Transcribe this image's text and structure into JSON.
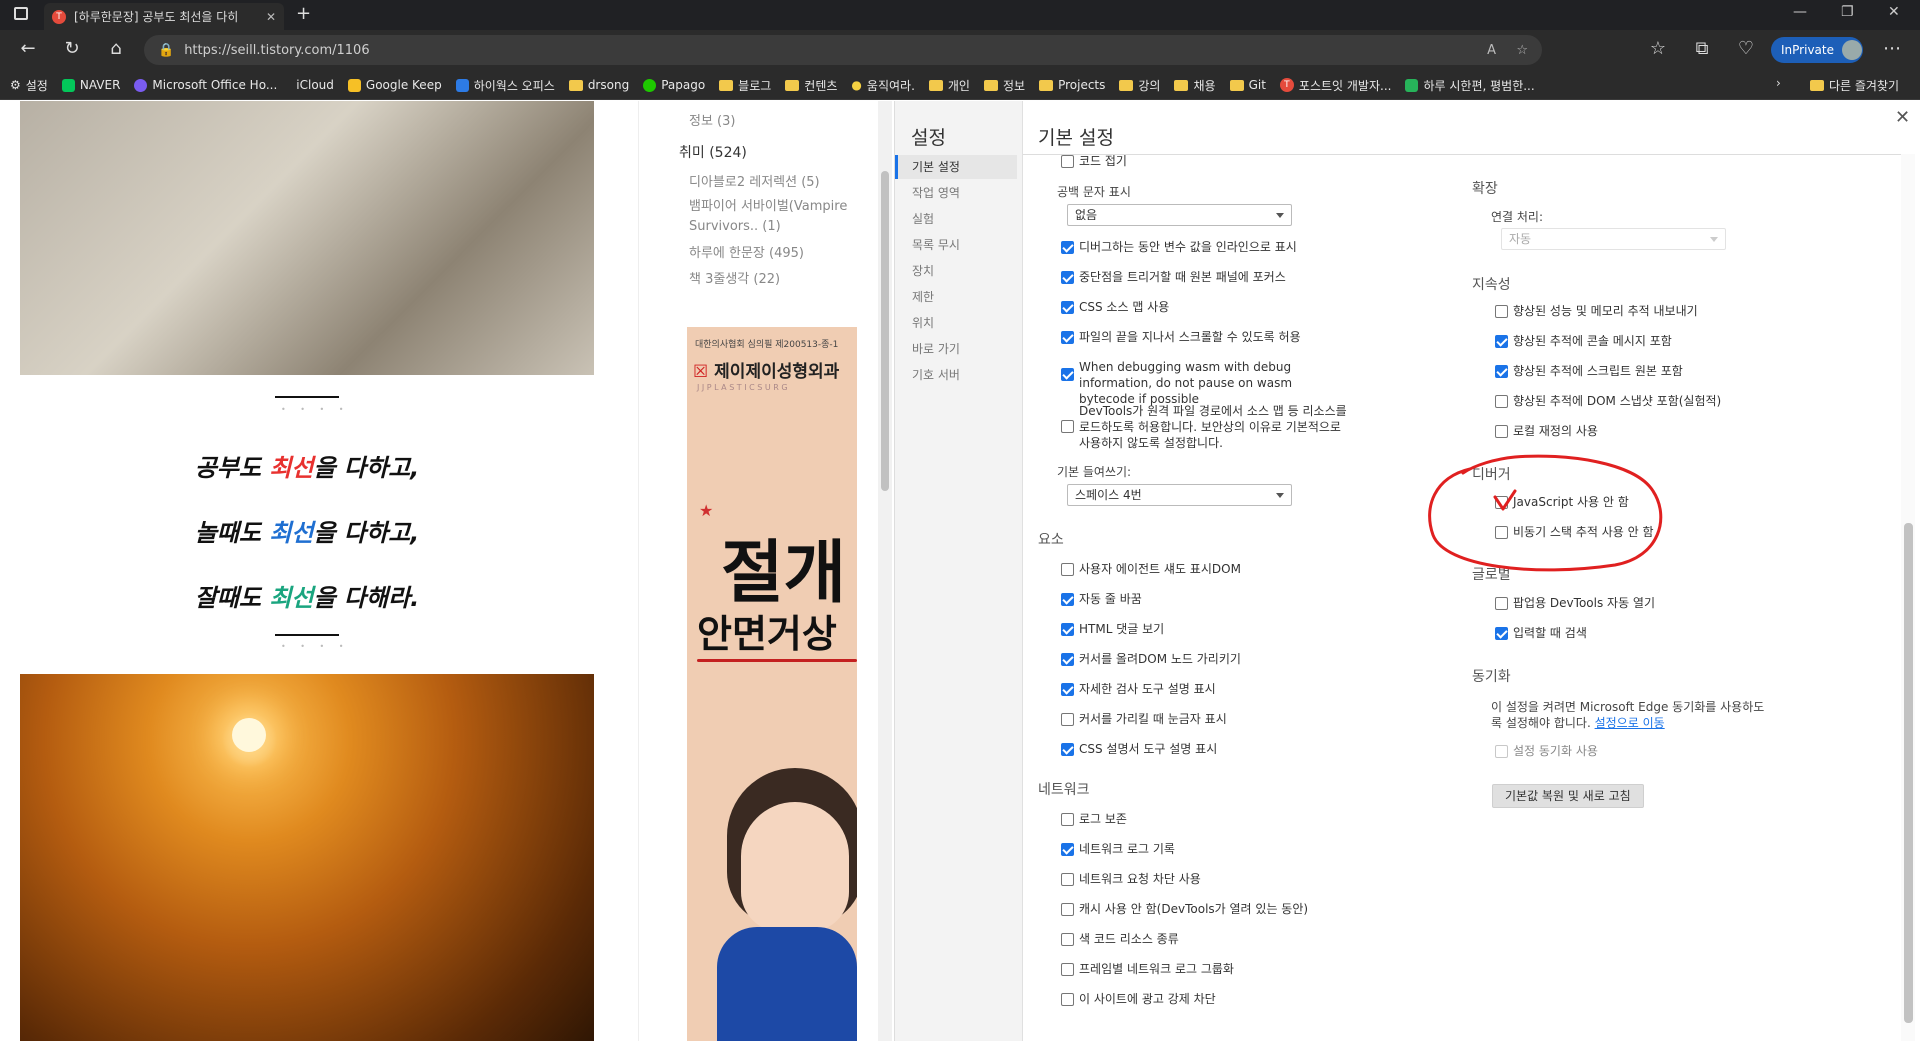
{
  "tab": {
    "title": "[하루한문장] 공부도 최선을 다히"
  },
  "address": {
    "url": "https://seill.tistory.com/1106",
    "inprivate": "InPrivate"
  },
  "favorites": {
    "items": [
      "설정",
      "NAVER",
      "Microsoft Office Ho...",
      "iCloud",
      "Google Keep",
      "하이웍스 오피스",
      "drsong",
      "Papago",
      "블로그",
      "컨텐츠",
      "움직여라.",
      "개인",
      "정보",
      "Projects",
      "강의",
      "채용",
      "Git",
      "포스트잇 개발자...",
      "하루 시한편, 평범한..."
    ],
    "others": "다른 즐겨찾기"
  },
  "blog": {
    "quote": {
      "l1a": "공부도 ",
      "l1b": "최선",
      "l1c": "을 다하고,",
      "l2a": "놀때도 ",
      "l2b": "최선",
      "l2c": "을 다하고,",
      "l3a": "잘때도 ",
      "l3b": "최선",
      "l3c": "을 다해라."
    },
    "categories": {
      "info": "정보 (3)",
      "hobby": "취미 (524)",
      "diablo": "디아블로2 레저렉션 (5)",
      "vampire": "뱀파이어 서바이벌(Vampire Survivors.. (1)",
      "daily": "하루에 한문장 (495)",
      "book": "책 3줄생각 (22)"
    },
    "ad": {
      "license": "대한의사협회 심의필 제200513-종-1",
      "clinic": "제이제이성형외과",
      "clinic_en": "J J P L A S T I C   S U R G",
      "headline1": "절개",
      "headline2": "안면거상"
    }
  },
  "devtools": {
    "nav_title": "설정",
    "nav": [
      "기본 설정",
      "작업 영역",
      "실험",
      "목록 무시",
      "장치",
      "제한",
      "위치",
      "바로 가기",
      "기호 서버"
    ],
    "header": "기본 설정",
    "col1": {
      "code_fold": "코드 접기",
      "whitespace_label": "공백 문자 표시",
      "whitespace_value": "없음",
      "inline_vars": "디버그하는 동안 변수 값을 인라인으로 표시",
      "focus_panel": "중단점을 트리거할 때 원본 패널에 포커스",
      "css_sourcemap": "CSS 소스 맵 사용",
      "scroll_past": "파일의 끝을 지나서 스크롤할 수 있도록 허용",
      "wasm": "When debugging wasm with debug information, do not pause on wasm bytecode if possible",
      "remote_paths": "DevTools가 원격 파일 경로에서 소스 맵 등 리소스를 로드하도록 허용합니다. 보안상의 이유로 기본적으로 사용하지 않도록 설정합니다.",
      "indent_label": "기본 들여쓰기:",
      "indent_value": "스페이스 4번",
      "elements_title": "요소",
      "shadow_dom": "사용자 에이전트 섀도 표시DOM",
      "word_wrap": "자동 줄 바꿈",
      "html_comments": "HTML 댓글 보기",
      "hover_dom": "커서를 올려DOM 노드 가리키기",
      "detailed_tooltip": "자세한 검사 도구 설명 표시",
      "ruler": "커서를 가리킬 때 눈금자 표시",
      "css_docs": "CSS 설명서 도구 설명 표시",
      "network_title": "네트워크",
      "preserve_log": "로그 보존",
      "network_log": "네트워크 로그 기록",
      "request_block": "네트워크 요청 차단 사용",
      "disable_cache": "캐시 사용 안 함(DevTools가 열려 있는 동안)",
      "color_sort": "색 코드 리소스 종류",
      "group_frame": "프레임별 네트워크 로그 그룹화",
      "force_block_ads": "이 사이트에 광고 강제 차단"
    },
    "col2": {
      "extensions_title": "확장",
      "link_handling": "연결 처리:",
      "link_value": "자동",
      "persistence_title": "지속성",
      "export_trace": "향상된 성능 및 메모리 추적 내보내기",
      "trace_console": "향상된 추적에 콘솔 메시지 포함",
      "trace_script": "향상된 추적에 스크립트 원본 포함",
      "trace_dom": "향상된 추적에 DOM 스냅샷 포함(실험적)",
      "local_override": "로컬 재정의 사용",
      "debugger_title": "디버거",
      "disable_js": "JavaScript 사용 안 함",
      "disable_async": "비동기 스택 추적 사용 안 함",
      "global_title": "글로벌",
      "auto_open": "팝업용 DevTools 자동 열기",
      "search_typing": "입력할 때 검색",
      "sync_title": "동기화",
      "sync_desc": "이 설정을 켜려면 Microsoft Edge 동기화를 사용하도록 설정해야 합니다.",
      "sync_link": "설정으로 이동",
      "sync_enable": "설정 동기화 사용",
      "restore": "기본값 복원 및 새로 고침"
    }
  },
  "colors": {
    "accent": "#1a73e8",
    "annotation": "#e02020",
    "highlight_red": "#e8312f",
    "highlight_blue": "#1f6fd1",
    "highlight_green": "#1aa57f"
  }
}
